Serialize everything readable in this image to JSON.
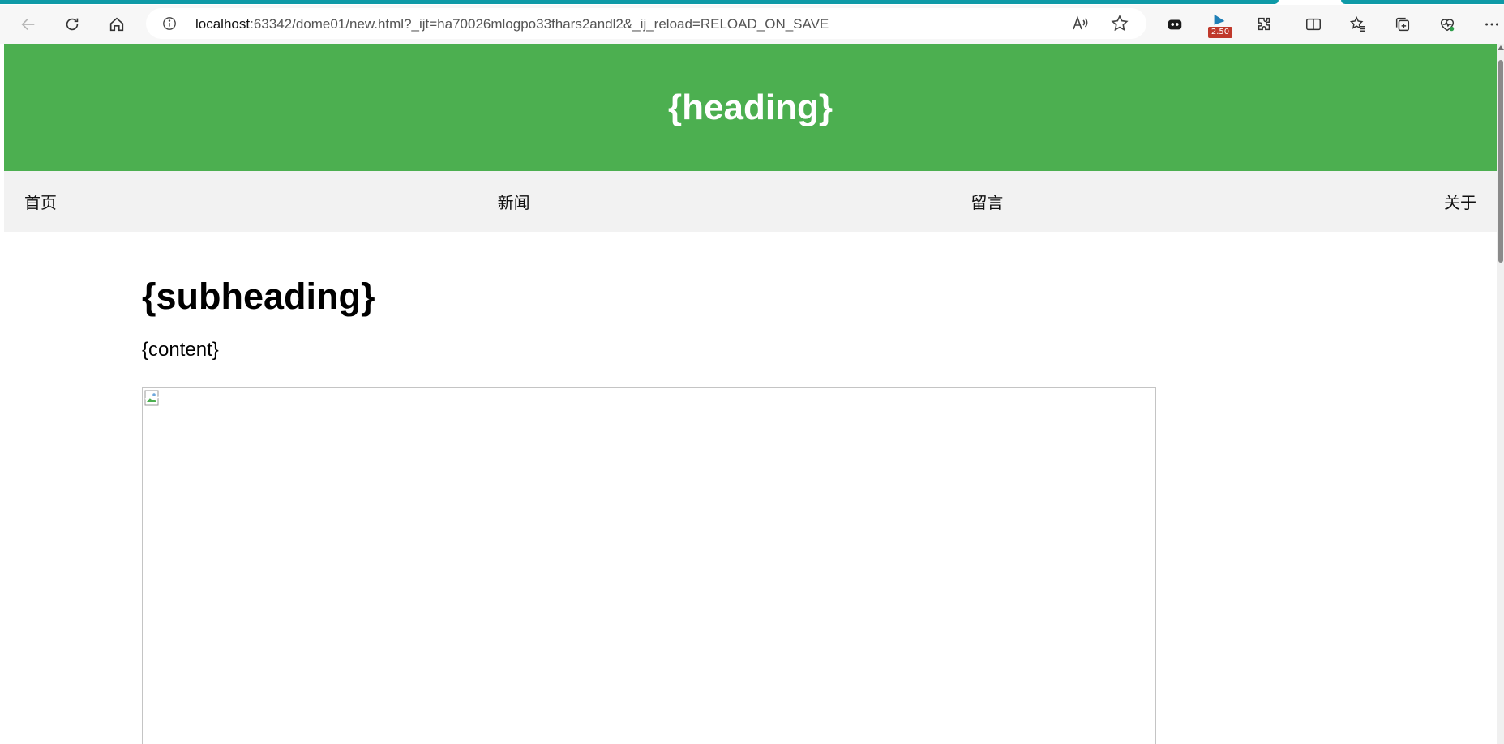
{
  "browser": {
    "url_host": "localhost",
    "url_rest": ":63342/dome01/new.html?_ijt=ha70026mlogpo33fhars2andl2&_ij_reload=RELOAD_ON_SAVE",
    "extension_badge": "2.50",
    "icons": [
      "back-icon",
      "refresh-icon",
      "home-icon",
      "info-icon",
      "read-aloud-icon",
      "favorite-star-icon",
      "extension-copilot-icon",
      "extension-flag-icon",
      "puzzle-extensions-icon",
      "split-screen-icon",
      "favorites-icon",
      "collections-icon",
      "browser-essentials-icon",
      "more-icon"
    ],
    "accent": "#0e9aa7"
  },
  "page": {
    "heading": "{heading}",
    "nav": [
      {
        "label": "首页"
      },
      {
        "label": "新闻"
      },
      {
        "label": "留言"
      },
      {
        "label": "关于"
      }
    ],
    "subheading": "{subheading}",
    "content": "{content}",
    "header_color": "#4caf50",
    "nav_background": "#f2f2f2"
  }
}
